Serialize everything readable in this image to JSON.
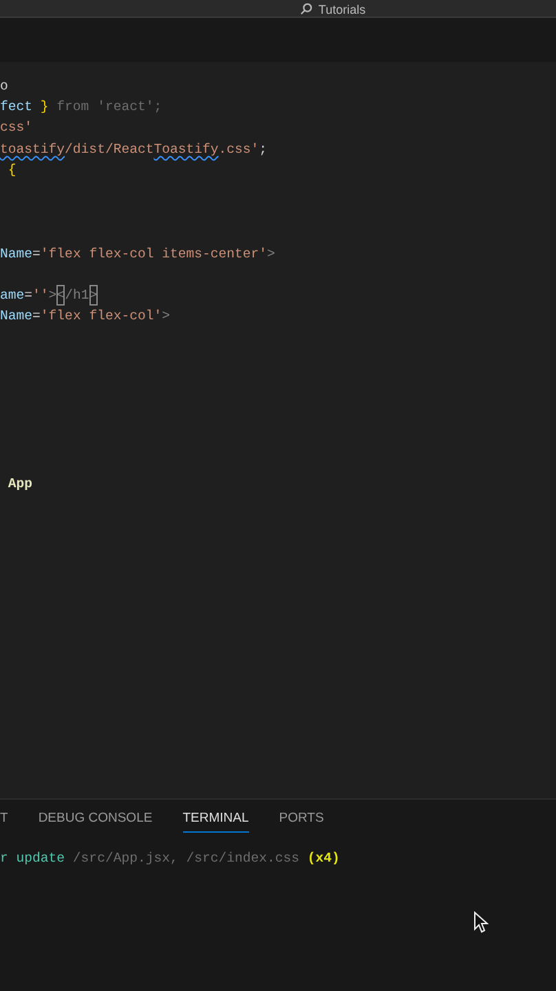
{
  "title_bar": {
    "search_label": "Tutorials"
  },
  "editor": {
    "lines": [
      {
        "kind": "code",
        "tokens": [
          {
            "text": "o",
            "kind": "plain"
          }
        ]
      },
      {
        "kind": "code",
        "tokens": [
          {
            "text": "fect",
            "kind": "variable"
          },
          {
            "text": " } ",
            "kind": "brace"
          },
          {
            "text": "from 'react';",
            "kind": "dim"
          }
        ]
      },
      {
        "kind": "code",
        "tokens": [
          {
            "text": "css'",
            "kind": "string"
          }
        ]
      },
      {
        "kind": "code",
        "tokens": [
          {
            "text": "toastify",
            "kind": "string-error"
          },
          {
            "text": "/dist/React",
            "kind": "string"
          },
          {
            "text": "Toastify",
            "kind": "string-error"
          },
          {
            "text": ".css'",
            "kind": "string"
          },
          {
            "text": ";",
            "kind": "plain"
          }
        ]
      },
      {
        "kind": "code",
        "tokens": [
          {
            "text": " {",
            "kind": "brace"
          }
        ]
      },
      {
        "kind": "blank"
      },
      {
        "kind": "blank"
      },
      {
        "kind": "blank"
      },
      {
        "kind": "code",
        "tokens": [
          {
            "text": "Name",
            "kind": "variable"
          },
          {
            "text": "=",
            "kind": "plain"
          },
          {
            "text": "'flex flex-col items-center'",
            "kind": "string"
          },
          {
            "text": ">",
            "kind": "punct"
          }
        ]
      },
      {
        "kind": "blank"
      },
      {
        "kind": "code",
        "tokens": [
          {
            "text": "ame",
            "kind": "variable"
          },
          {
            "text": "=",
            "kind": "plain"
          },
          {
            "text": "''",
            "kind": "string"
          },
          {
            "text": ">",
            "kind": "punct"
          },
          {
            "text": "<",
            "kind": "bracket-match"
          },
          {
            "text": "/h1",
            "kind": "tag"
          },
          {
            "text": ">",
            "kind": "bracket-match"
          }
        ]
      },
      {
        "kind": "code",
        "tokens": [
          {
            "text": "Name",
            "kind": "variable"
          },
          {
            "text": "=",
            "kind": "plain"
          },
          {
            "text": "'flex flex-col'",
            "kind": "string"
          },
          {
            "text": ">",
            "kind": "punct"
          }
        ]
      },
      {
        "kind": "blank"
      },
      {
        "kind": "blank"
      },
      {
        "kind": "blank"
      },
      {
        "kind": "blank"
      },
      {
        "kind": "blank"
      },
      {
        "kind": "blank"
      },
      {
        "kind": "blank"
      },
      {
        "kind": "code",
        "tokens": [
          {
            "text": " App",
            "kind": "name"
          }
        ]
      }
    ]
  },
  "panel": {
    "tabs": [
      {
        "label": "T",
        "selected": false
      },
      {
        "label": "DEBUG CONSOLE",
        "selected": false
      },
      {
        "label": "TERMINAL",
        "selected": true
      },
      {
        "label": "PORTS",
        "selected": false
      }
    ],
    "terminal_lines": [
      {
        "tokens": [
          {
            "text": "r ",
            "kind": "green"
          },
          {
            "text": "update",
            "kind": "green"
          },
          {
            "text": " /src/App.jsx, /src/index.css ",
            "kind": "dim"
          },
          {
            "text": "(x4)",
            "kind": "yellow"
          }
        ]
      }
    ]
  }
}
